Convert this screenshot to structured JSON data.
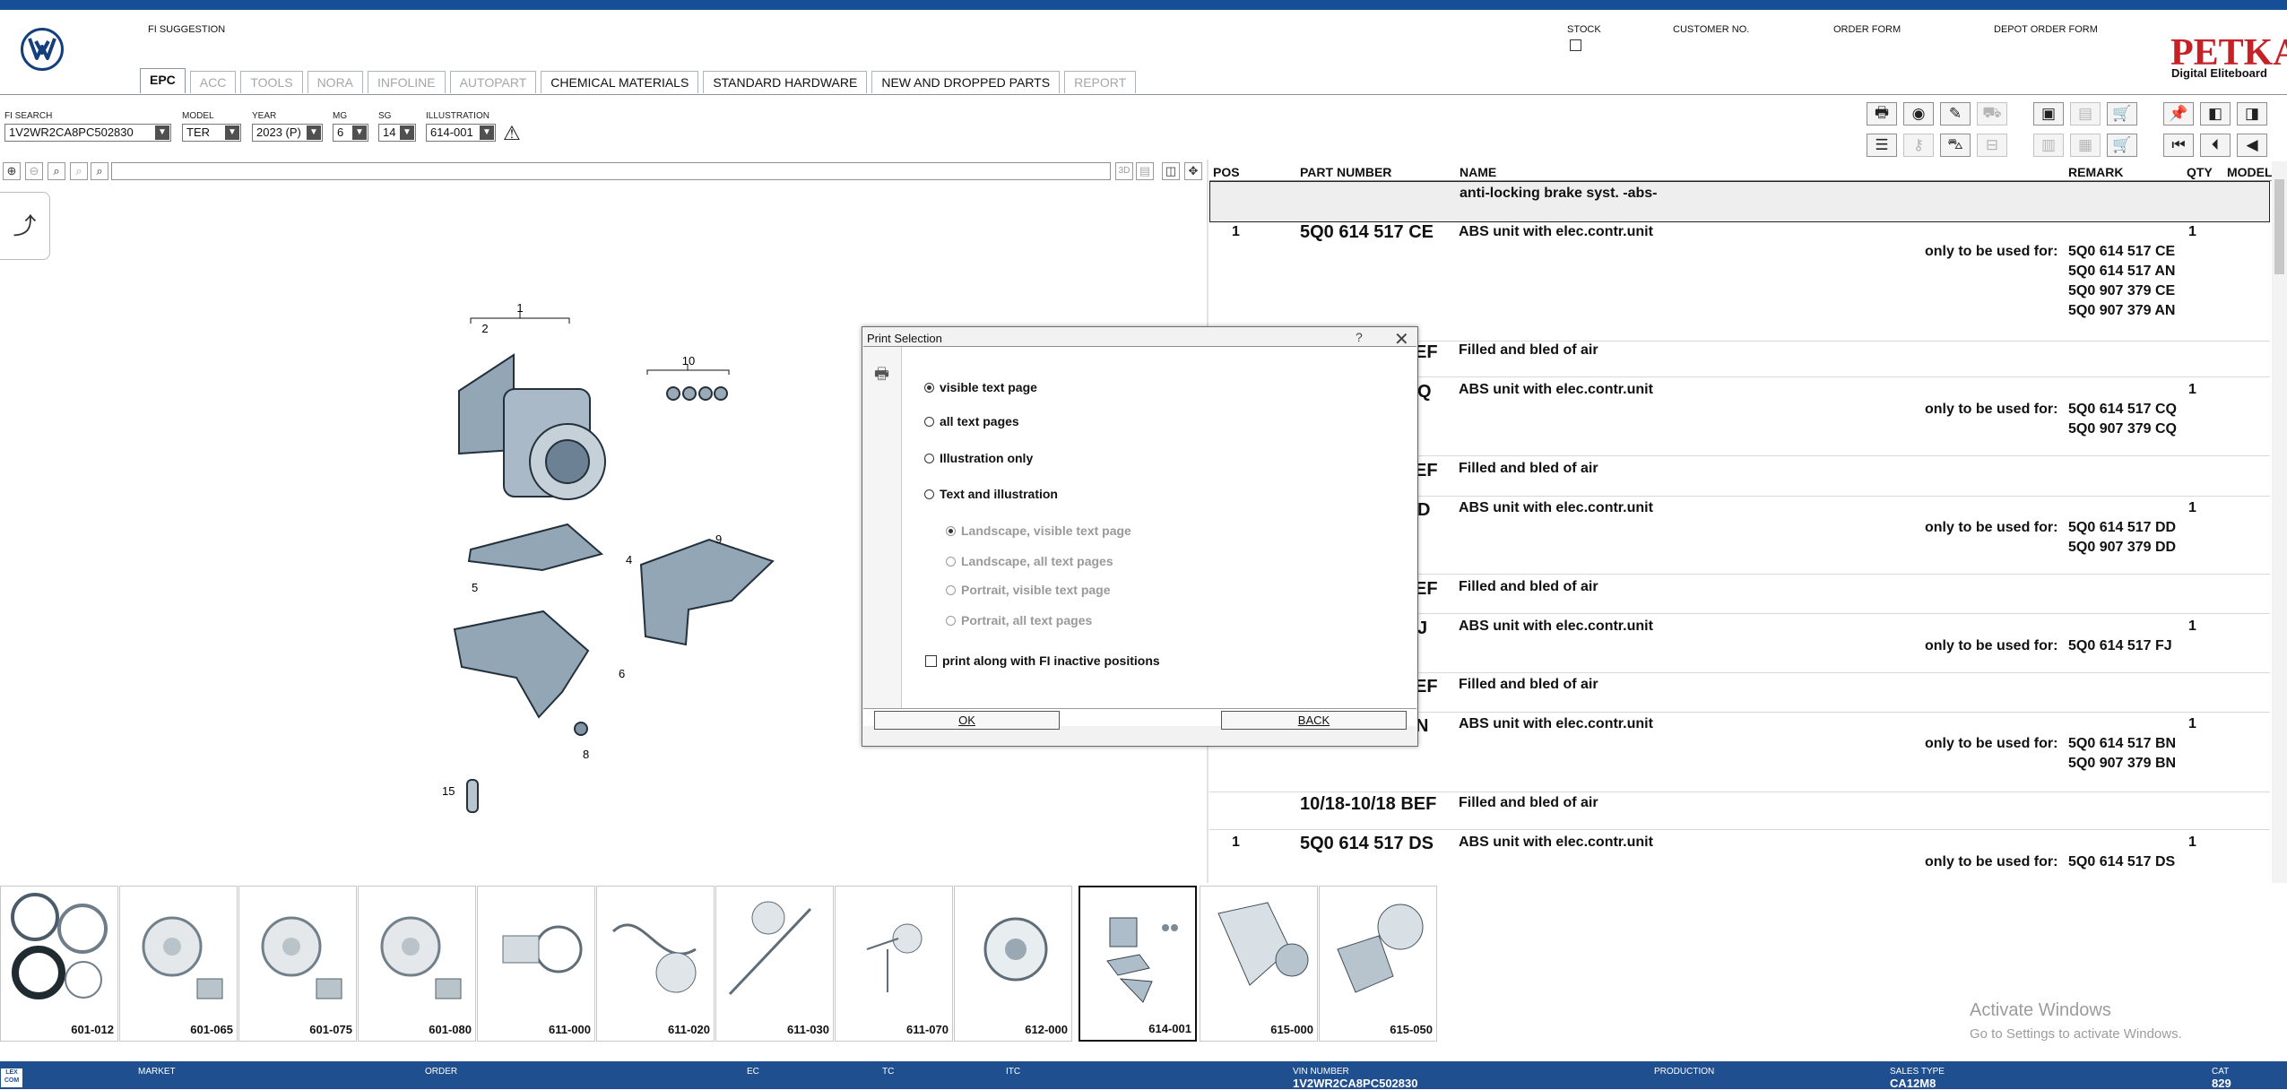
{
  "header": {
    "fi_suggestion": "FI SUGGESTION",
    "stock": "STOCK",
    "customer_no": "CUSTOMER NO.",
    "order_form": "ORDER FORM",
    "depot_order_form": "DEPOT ORDER FORM",
    "brand_title": "PETKA",
    "brand_subtitle": "Digital Eliteboard"
  },
  "tabs": [
    {
      "label": "EPC",
      "state": "active"
    },
    {
      "label": "ACC",
      "state": "disabled"
    },
    {
      "label": "TOOLS",
      "state": "disabled"
    },
    {
      "label": "NORA",
      "state": "disabled"
    },
    {
      "label": "INFOLINE",
      "state": "disabled"
    },
    {
      "label": "AUTOPART",
      "state": "disabled"
    },
    {
      "label": "CHEMICAL MATERIALS",
      "state": "enabled"
    },
    {
      "label": "STANDARD HARDWARE",
      "state": "enabled"
    },
    {
      "label": "NEW AND DROPPED PARTS",
      "state": "enabled"
    },
    {
      "label": "REPORT",
      "state": "disabled"
    }
  ],
  "filters": {
    "fi_search_label": "FI SEARCH",
    "fi_search_value": "1V2WR2CA8PC502830",
    "model_label": "MODEL",
    "model_value": "TER",
    "year_label": "YEAR",
    "year_value": "2023 (P)",
    "mg_label": "MG",
    "mg_value": "6",
    "sg_label": "SG",
    "sg_value": "14",
    "illustration_label": "ILLUSTRATION",
    "illustration_value": "614-001"
  },
  "toolbar": {
    "mode_3d": "3D"
  },
  "illustration": {
    "callouts": [
      "1",
      "2",
      "10",
      "4",
      "5",
      "9",
      "6",
      "8",
      "15"
    ]
  },
  "parts_table": {
    "columns": [
      "POS",
      "PART NUMBER",
      "NAME",
      "REMARK",
      "QTY",
      "MODEL"
    ],
    "group_title": "anti-locking brake syst. -abs-",
    "rows": [
      {
        "pos": "1",
        "part": "5Q0 614 517 CE",
        "name": "ABS unit with elec.contr.unit",
        "qty": "1",
        "remark": "only to be used for:",
        "numbers": [
          "5Q0 614 517 CE",
          "5Q0 614 517 AN",
          "5Q0 907 379 CE",
          "5Q0 907 379 AN"
        ]
      },
      {
        "pos": "",
        "part": "EF",
        "name": "Filled and bled of air",
        "qty": "",
        "remark": "",
        "numbers": []
      },
      {
        "pos": "",
        "part": "Q",
        "name": "ABS unit with elec.contr.unit",
        "qty": "1",
        "remark": "only to be used for:",
        "numbers": [
          "5Q0 614 517 CQ",
          "5Q0 907 379 CQ"
        ]
      },
      {
        "pos": "",
        "part": "EF",
        "name": "Filled and bled of air",
        "qty": "",
        "remark": "",
        "numbers": []
      },
      {
        "pos": "",
        "part": "D",
        "name": "ABS unit with elec.contr.unit",
        "qty": "1",
        "remark": "only to be used for:",
        "numbers": [
          "5Q0 614 517 DD",
          "5Q0 907 379 DD"
        ]
      },
      {
        "pos": "",
        "part": "EF",
        "name": "Filled and bled of air",
        "qty": "",
        "remark": "",
        "numbers": []
      },
      {
        "pos": "",
        "part": "J",
        "name": "ABS unit with elec.contr.unit",
        "qty": "1",
        "remark": "only to be used for:",
        "numbers": [
          "5Q0 614 517 FJ"
        ]
      },
      {
        "pos": "",
        "part": "EF",
        "name": "Filled and bled of air",
        "qty": "",
        "remark": "",
        "numbers": []
      },
      {
        "pos": "",
        "part": "N",
        "name": "ABS unit with elec.contr.unit",
        "qty": "1",
        "remark": "only to be used for:",
        "numbers": [
          "5Q0 614 517 BN",
          "5Q0 907 379 BN"
        ]
      },
      {
        "pos": "",
        "part": "10/18-10/18 BEF",
        "name": "Filled and bled of air",
        "qty": "",
        "remark": "",
        "numbers": []
      },
      {
        "pos": "1",
        "part": "5Q0 614 517 DS",
        "name": "ABS unit with elec.contr.unit",
        "qty": "1",
        "remark": "only to be used for:",
        "numbers": [
          "5Q0 614 517 DS"
        ]
      }
    ]
  },
  "dialog": {
    "title": "Print Selection",
    "help": "?",
    "close": "✕",
    "options": [
      {
        "label": "visible text page",
        "selected": true
      },
      {
        "label": "all text pages",
        "selected": false
      },
      {
        "label": "Illustration only",
        "selected": false
      },
      {
        "label": "Text and illustration",
        "selected": false
      }
    ],
    "layout_options": [
      {
        "label": "Landscape, visible text page",
        "selected": true
      },
      {
        "label": "Landscape, all text pages",
        "selected": false
      },
      {
        "label": "Portrait, visible text page",
        "selected": false
      },
      {
        "label": "Portrait, all text pages",
        "selected": false
      }
    ],
    "checkbox_label": "print along with FI inactive positions",
    "ok": "OK",
    "back": "BACK"
  },
  "thumbnails": [
    "601-012",
    "601-065",
    "601-075",
    "601-080",
    "611-000",
    "611-020",
    "611-030",
    "611-070",
    "612-000",
    "614-001",
    "615-000",
    "615-050"
  ],
  "watermark": {
    "line1": "Activate Windows",
    "line2": "Go to Settings to activate Windows."
  },
  "status": {
    "lexcom": "LEX COM",
    "market_label": "MARKET",
    "order_label": "ORDER",
    "ec_label": "EC",
    "tc_label": "TC",
    "itc_label": "ITC",
    "vin_label": "VIN NUMBER",
    "vin_value": "1V2WR2CA8PC502830",
    "production_label": "PRODUCTION",
    "sales_type_label": "SALES TYPE",
    "sales_type_value": "CA12M8",
    "cat_label": "CAT",
    "cat_value": "829"
  }
}
